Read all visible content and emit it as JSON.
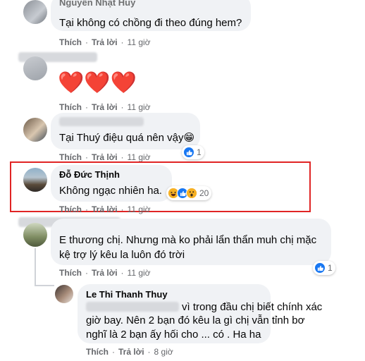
{
  "actions": {
    "like": "Thích",
    "reply": "Trả lời",
    "sep": "·"
  },
  "comments": [
    {
      "name": "Nguyễn Nhật Huy",
      "text": "Tại không có chồng đi theo đúng hem?",
      "time": "11 giờ"
    },
    {
      "name": "",
      "text": "❤️❤️❤️",
      "time": "11 giờ"
    },
    {
      "name": "",
      "text": "Tại Thuý điệu quá nên vậy😁",
      "time": "11 giờ",
      "reaction_count": "1"
    },
    {
      "name": "Đỗ Đức Thịnh",
      "text": "Không ngạc nhiên ha.",
      "time": "11 giờ",
      "reaction_count": "20"
    },
    {
      "name": "",
      "text_line1": "E thương chị. Nhưng mà ko phải lẩn thẩn muh chị mặc",
      "text_line2": "kệ trợ lý kêu la luôn đó trời",
      "time": "11 giờ",
      "reaction_count": "1"
    }
  ],
  "reply": {
    "name": "Le Thi Thanh Thuy",
    "line1_suffix": "vì trong đầu chị biết chính xác",
    "line2": "giờ bay. Nên 2 bạn đó kêu la gì chị vẫn tỉnh bơ",
    "line3": "nghĩ là 2 bạn ấy hối cho ... có . Ha ha",
    "time": "8 giờ"
  },
  "colors": {
    "bubble": "#f0f2f5",
    "highlight": "#e02424",
    "like_blue": "#1877f2",
    "haha_yellow": "#f7b125",
    "muted": "#65676b"
  }
}
